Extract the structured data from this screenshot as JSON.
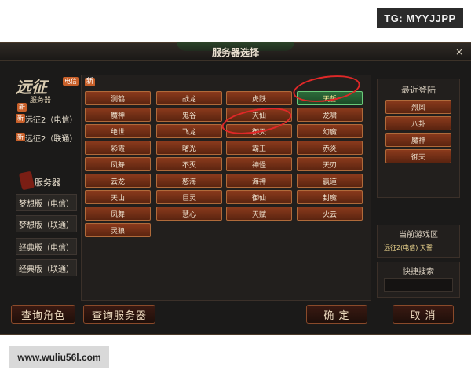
{
  "watermarks": {
    "top": "TG: MYYJJPP",
    "bottom": "www.wuliu56l.com"
  },
  "window": {
    "title": "服务器选择",
    "close_icon": "×"
  },
  "logo": {
    "main": "远征",
    "sub": "服务器",
    "badge": "电信"
  },
  "left_servers": {
    "badge": "新",
    "items": [
      {
        "badge": "新",
        "label": "远征2（电信）"
      },
      {
        "badge": "新",
        "label": "远征2（联通）"
      }
    ]
  },
  "server_section": {
    "title": "服务器",
    "items": [
      "梦想版（电信）",
      "梦想版（联通）",
      "经典版（电信）",
      "经典版（联通）"
    ]
  },
  "grid_badge": "新",
  "servers": [
    [
      "测鹤",
      "战龙",
      "虎跃",
      "天誓"
    ],
    [
      "魔神",
      "鬼谷",
      "天仙",
      "龙啸"
    ],
    [
      "绝世",
      "飞龙",
      "御天",
      "幻魔"
    ],
    [
      "彩霞",
      "曙光",
      "霸王",
      "赤炎"
    ],
    [
      "凤舞",
      "不灭",
      "神怪",
      "天刃"
    ],
    [
      "云龙",
      "憨海",
      "海神",
      "赢道"
    ],
    [
      "天山",
      "巨灵",
      "御仙",
      "封魔"
    ],
    [
      "凤舞",
      "慧心",
      "天赋",
      "火云"
    ],
    [
      "灵狼",
      "",
      "",
      ""
    ]
  ],
  "selected_server": "天誓",
  "recent": {
    "title": "最近登陆",
    "items": [
      "烈风",
      "八卦",
      "魔神",
      "御天"
    ]
  },
  "current_zone": {
    "title": "当前游戏区",
    "value": "远征2(电信) 天誓"
  },
  "quick_search": {
    "title": "快捷搜索"
  },
  "buttons": {
    "query_role": "查询角色",
    "query_server": "查询服务器",
    "confirm": "确  定",
    "cancel": "取  消"
  }
}
